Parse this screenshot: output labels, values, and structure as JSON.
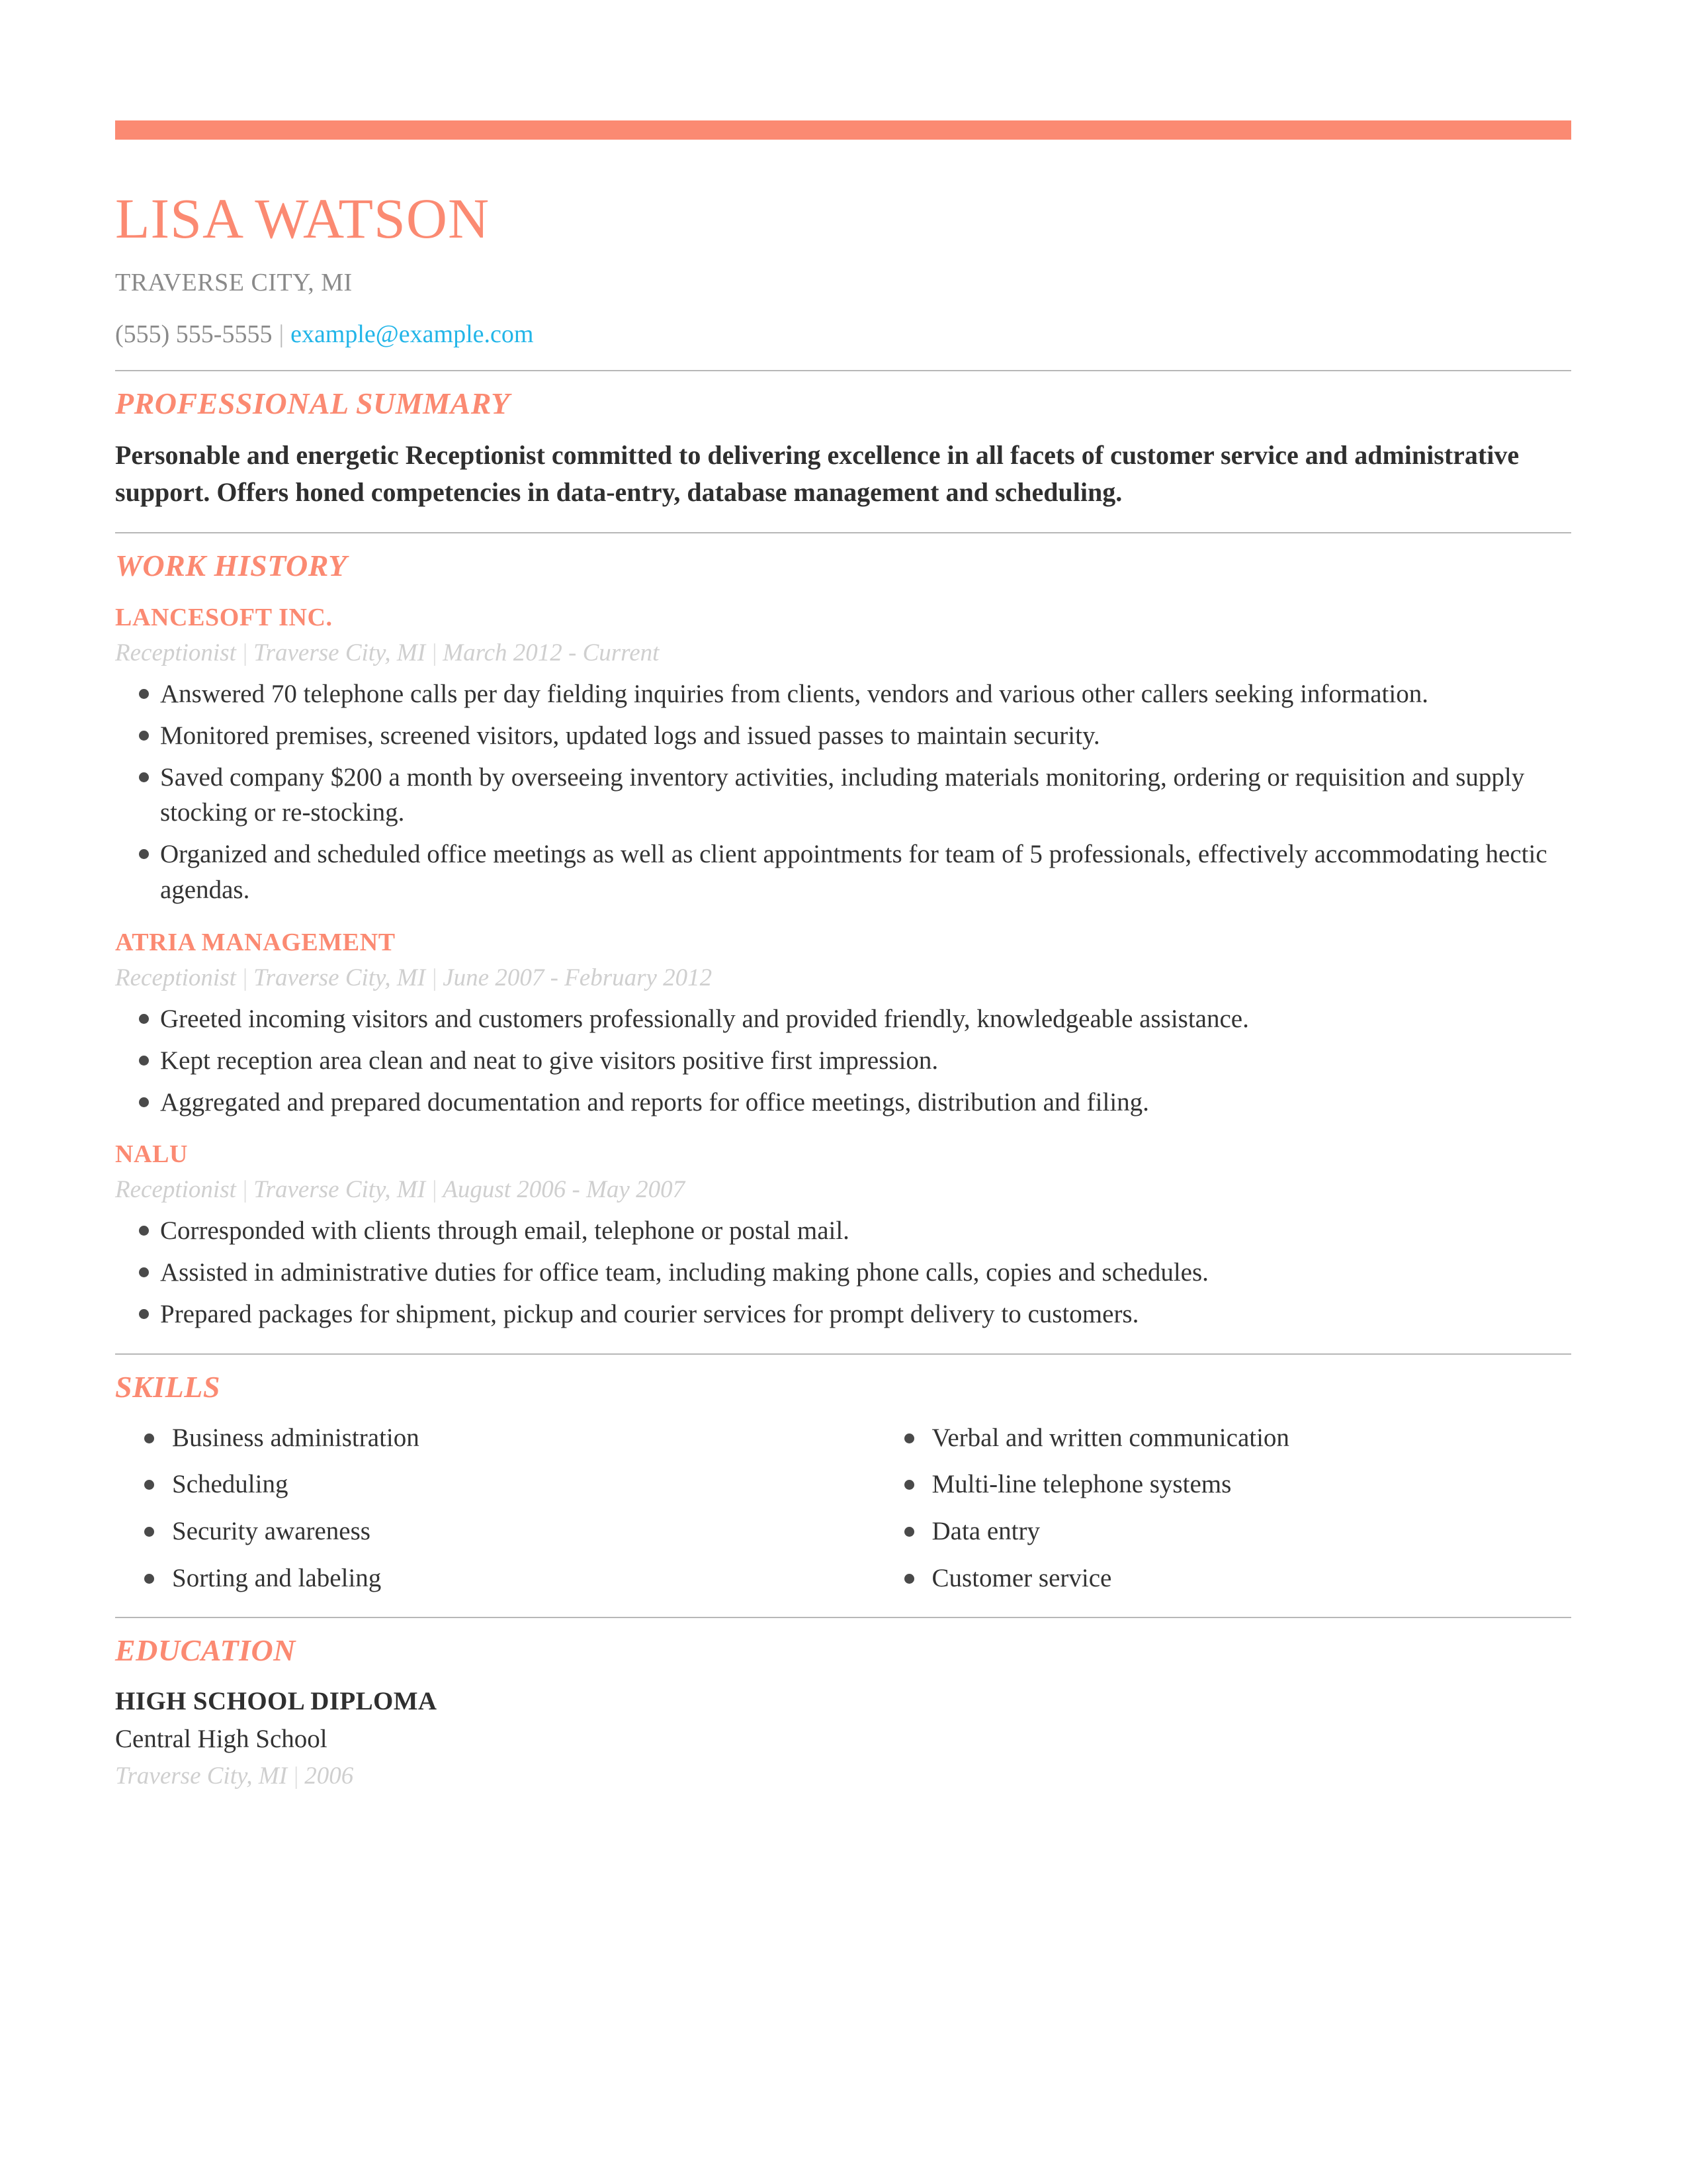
{
  "theme": {
    "accent": "#fb8a72",
    "link": "#22b5e8",
    "meta_gray": "#cfcfcf",
    "body": "#333333"
  },
  "header": {
    "name": "LISA WATSON",
    "location": "TRAVERSE CITY, MI",
    "phone": "(555) 555-5555",
    "separator": "|",
    "email": "example@example.com"
  },
  "sections": {
    "summary": {
      "title": "PROFESSIONAL SUMMARY",
      "text": "Personable and energetic Receptionist committed to delivering excellence in all facets of customer service and administrative support. Offers honed competencies in data-entry, database management and scheduling."
    },
    "work_history": {
      "title": "WORK HISTORY",
      "jobs": [
        {
          "company": "LANCESOFT INC.",
          "role": "Receptionist",
          "location": "Traverse City, MI",
          "dates": "March 2012 - Current",
          "bullets": [
            "Answered 70 telephone calls per day fielding inquiries from clients, vendors and various other callers seeking information.",
            "Monitored premises, screened visitors, updated logs and issued passes to maintain security.",
            "Saved company $200 a month by overseeing inventory activities, including materials monitoring, ordering or requisition and supply stocking or re-stocking.",
            "Organized and scheduled office meetings as well as client appointments for team of 5 professionals, effectively accommodating hectic agendas."
          ]
        },
        {
          "company": "ATRIA MANAGEMENT",
          "role": "Receptionist",
          "location": "Traverse City, MI",
          "dates": "June 2007 - February 2012",
          "bullets": [
            "Greeted incoming visitors and customers professionally and provided friendly, knowledgeable assistance.",
            "Kept reception area clean and neat to give visitors positive first impression.",
            "Aggregated and prepared documentation and reports for office meetings, distribution and filing."
          ]
        },
        {
          "company": "NALU",
          "role": "Receptionist",
          "location": "Traverse City, MI",
          "dates": "August 2006 - May 2007",
          "bullets": [
            "Corresponded with clients through email, telephone or postal mail.",
            "Assisted in administrative duties for office team, including making phone calls, copies and schedules.",
            "Prepared packages for shipment, pickup and courier services for prompt delivery to customers."
          ]
        }
      ]
    },
    "skills": {
      "title": "SKILLS",
      "left": [
        "Business administration",
        "Scheduling",
        "Security awareness",
        "Sorting and labeling"
      ],
      "right": [
        "Verbal and written communication",
        "Multi-line telephone systems",
        "Data entry",
        "Customer service"
      ]
    },
    "education": {
      "title": "EDUCATION",
      "degree": "HIGH SCHOOL DIPLOMA",
      "school": "Central High School",
      "location": "Traverse City, MI",
      "year": "2006"
    }
  }
}
